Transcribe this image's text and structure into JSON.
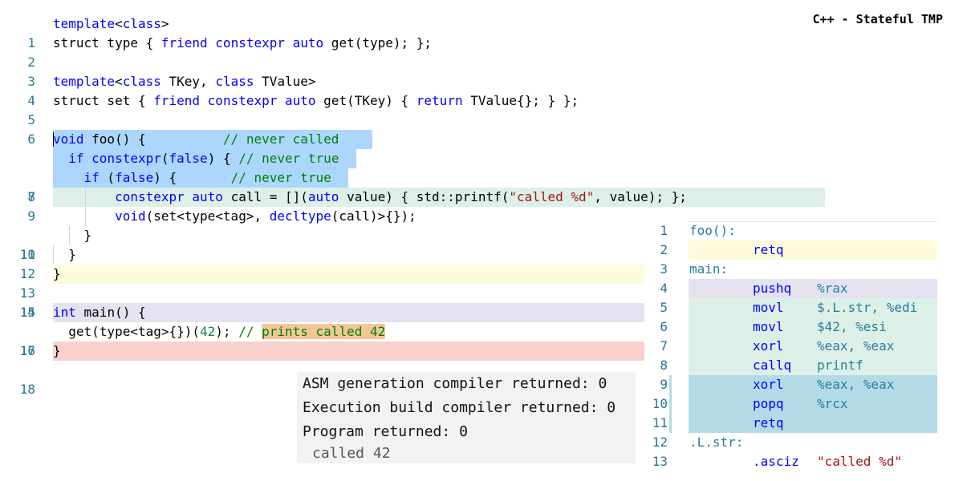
{
  "title": "C++ - Stateful TMP",
  "colors": {
    "selection": "#add6ff",
    "mint": "#dcf0e8",
    "yellow": "#fdfbdc",
    "lavender": "#e4e2ef",
    "salmon": "#f8d1cc",
    "orange": "#f3c69a",
    "asm_blue": "#b4dae8"
  },
  "source": {
    "line_numbers": [
      "1",
      "2",
      "3",
      "4",
      "5",
      "6",
      "7",
      "8",
      "9",
      "10",
      "11",
      "12",
      "13",
      "14",
      "15",
      "16",
      "17",
      "18"
    ],
    "l1": {
      "kw": "template",
      "rest": "<",
      "kw2": "class",
      "end": ">"
    },
    "l2": {
      "a": "struct type { ",
      "b": "friend",
      "c": " ",
      "d": "constexpr",
      "e": " ",
      "f": "auto",
      "g": " get(type); };"
    },
    "l4": {
      "a": "template",
      "b": "<",
      "c": "class",
      "d": " TKey, ",
      "e": "class",
      "f": " TValue>"
    },
    "l5": {
      "a": "struct set { ",
      "b": "friend",
      "c": " ",
      "d": "constexpr",
      "e": " ",
      "f": "auto",
      "g": " get(TKey) { ",
      "h": "return",
      "i": " TValue{}; } };"
    },
    "l7": {
      "a": "void",
      "b": " foo() {          ",
      "c": "// never called"
    },
    "l8": {
      "a": "  ",
      "b": "if",
      "c": " ",
      "d": "constexpr",
      "e": "(",
      "f": "false",
      "g": ") { ",
      "h": "// never true"
    },
    "l9": {
      "a": "    ",
      "b": "if",
      "c": " (",
      "d": "false",
      "e": ") {       ",
      "f": "// never true"
    },
    "l10": {
      "a": "        ",
      "b": "constexpr",
      "c": " ",
      "d": "auto",
      "e": " call = [](",
      "f": "auto",
      "g": " value) { std::printf(",
      "h": "\"called %d\"",
      "i": ", value); };"
    },
    "l11": {
      "a": "        ",
      "b": "void",
      "c": "(set<type<tag>, ",
      "d": "decltype",
      "e": "(call)>{});"
    },
    "l12": {
      "a": "    }"
    },
    "l13": {
      "a": "  }"
    },
    "l14": {
      "a": "}"
    },
    "l16": {
      "a": "int",
      "b": " main() {"
    },
    "l17": {
      "a": "  get(type<tag>{})(",
      "b": "42",
      "c": "); ",
      "d": "// ",
      "e": "prints called 42"
    },
    "l18": {
      "a": "}"
    }
  },
  "asm": {
    "line_numbers": [
      "1",
      "2",
      "3",
      "4",
      "5",
      "6",
      "7",
      "8",
      "9",
      "10",
      "11",
      "12",
      "13"
    ],
    "lines": [
      {
        "label": "foo():",
        "op": "",
        "args": ""
      },
      {
        "label": "",
        "op": "retq",
        "args": ""
      },
      {
        "label": "main:",
        "op": "",
        "args": ""
      },
      {
        "label": "",
        "op": "pushq",
        "args": "%rax"
      },
      {
        "label": "",
        "op": "movl",
        "args": "$.L.str, %edi"
      },
      {
        "label": "",
        "op": "movl",
        "args": "$42, %esi"
      },
      {
        "label": "",
        "op": "xorl",
        "args": "%eax, %eax"
      },
      {
        "label": "",
        "op": "callq",
        "args": "printf"
      },
      {
        "label": "",
        "op": "xorl",
        "args": "%eax, %eax"
      },
      {
        "label": "",
        "op": "popq",
        "args": "%rcx"
      },
      {
        "label": "",
        "op": "retq",
        "args": ""
      },
      {
        "label": ".L.str:",
        "op": "",
        "args": ""
      },
      {
        "label": "",
        "op": ".asciz",
        "args": "\"called %d\""
      }
    ]
  },
  "output": {
    "lines": [
      "ASM generation compiler returned: 0",
      "Execution build compiler returned: 0",
      "Program returned: 0"
    ],
    "program_output": "called 42"
  }
}
